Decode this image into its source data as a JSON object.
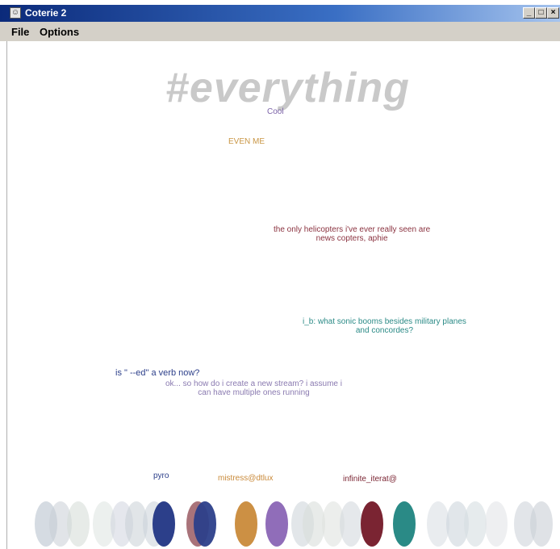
{
  "window": {
    "title": "Coterie 2"
  },
  "menu": {
    "file": "File",
    "options": "Options"
  },
  "window_buttons": {
    "minimize": "_",
    "maximize": "□",
    "close": "×"
  },
  "channel": {
    "title": "#everything"
  },
  "messages": [
    {
      "text": "Cool"
    },
    {
      "text": "EVEN ME"
    },
    {
      "line1": "the only helicopters i've ever really seen are",
      "line2": "news copters, aphie"
    },
    {
      "line1": "i_b: what sonic booms besides military planes",
      "line2": "and concordes?"
    },
    {
      "text": "is \" --ed\" a verb now?"
    },
    {
      "line1": "ok... so how do i create a new stream? i assume i",
      "line2": "can have multiple ones running"
    }
  ],
  "users": [
    {
      "name": "pyro",
      "color": "#2c3f8a"
    },
    {
      "name": "mistress@dtlux",
      "color": "#c98a3a"
    },
    {
      "name": "infinite_iterat@",
      "color": "#7a2432"
    }
  ],
  "colors": {
    "titlebar_start": "#0b2a7a",
    "titlebar_end": "#a6c4ee",
    "menubar": "#d4d0c8",
    "channel_title": "#c9c9c9"
  }
}
